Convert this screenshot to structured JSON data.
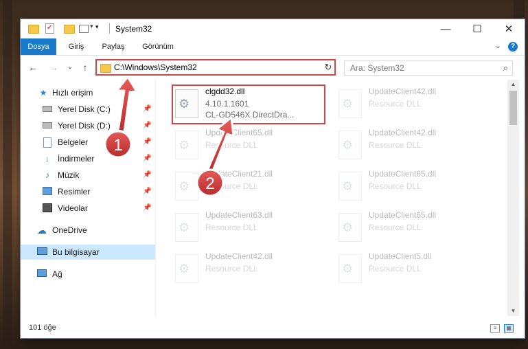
{
  "window": {
    "title": "System32"
  },
  "window_controls": {
    "minimize": "—",
    "maximize": "☐",
    "close": "✕"
  },
  "ribbon": {
    "tabs": [
      {
        "label": "Dosya",
        "active": true
      },
      {
        "label": "Giriş",
        "active": false
      },
      {
        "label": "Paylaş",
        "active": false
      },
      {
        "label": "Görünüm",
        "active": false
      }
    ],
    "help": "?"
  },
  "nav": {
    "path": "C:\\Windows\\System32",
    "search_placeholder": "Ara: System32"
  },
  "sidebar": {
    "items": [
      {
        "label": "Hızlı erişim",
        "icon": "star-icon",
        "pinned": false
      },
      {
        "label": "Yerel Disk (C:)",
        "icon": "drive-icon",
        "pinned": true
      },
      {
        "label": "Yerel Disk (D:)",
        "icon": "drive-icon",
        "pinned": true
      },
      {
        "label": "Belgeler",
        "icon": "document-icon",
        "pinned": true
      },
      {
        "label": "İndirmeler",
        "icon": "download-icon",
        "pinned": true
      },
      {
        "label": "Müzik",
        "icon": "music-icon",
        "pinned": true
      },
      {
        "label": "Resimler",
        "icon": "pictures-icon",
        "pinned": true
      },
      {
        "label": "Videolar",
        "icon": "video-icon",
        "pinned": true
      },
      {
        "label": "OneDrive",
        "icon": "cloud-icon",
        "pinned": false
      },
      {
        "label": "Bu bilgisayar",
        "icon": "computer-icon",
        "pinned": false,
        "selected": true
      },
      {
        "label": "Ağ",
        "icon": "network-icon",
        "pinned": false
      }
    ]
  },
  "files": [
    {
      "name": "clgdd32.dll",
      "line2": "4.10.1.1601",
      "line3": "CL-GD546X DirectDra...",
      "highlighted": true
    },
    {
      "name": "UpdateClient42.dll",
      "line2": "Resource DLL",
      "faded": true
    },
    {
      "name": "UpdateClient65.dll",
      "line2": "Resource DLL",
      "faded": true
    },
    {
      "name": "UpdateClient42.dll",
      "line2": "Resource DLL",
      "faded": true
    },
    {
      "name": "UpdateClient21.dll",
      "line2": "Resource DLL",
      "faded": true
    },
    {
      "name": "UpdateClient65.dll",
      "line2": "Resource DLL",
      "faded": true
    },
    {
      "name": "UpdateClient63.dll",
      "line2": "Resource DLL",
      "faded": true
    },
    {
      "name": "UpdateClient65.dll",
      "line2": "Resource DLL",
      "faded": true
    },
    {
      "name": "UpdateClient42.dll",
      "line2": "Resource DLL",
      "faded": true
    },
    {
      "name": "UpdateClient5.dll",
      "line2": "Resource DLL",
      "faded": true
    }
  ],
  "status": {
    "count": "101 öğe"
  },
  "annotations": {
    "step1": "1",
    "step2": "2",
    "color": "#d64545"
  }
}
